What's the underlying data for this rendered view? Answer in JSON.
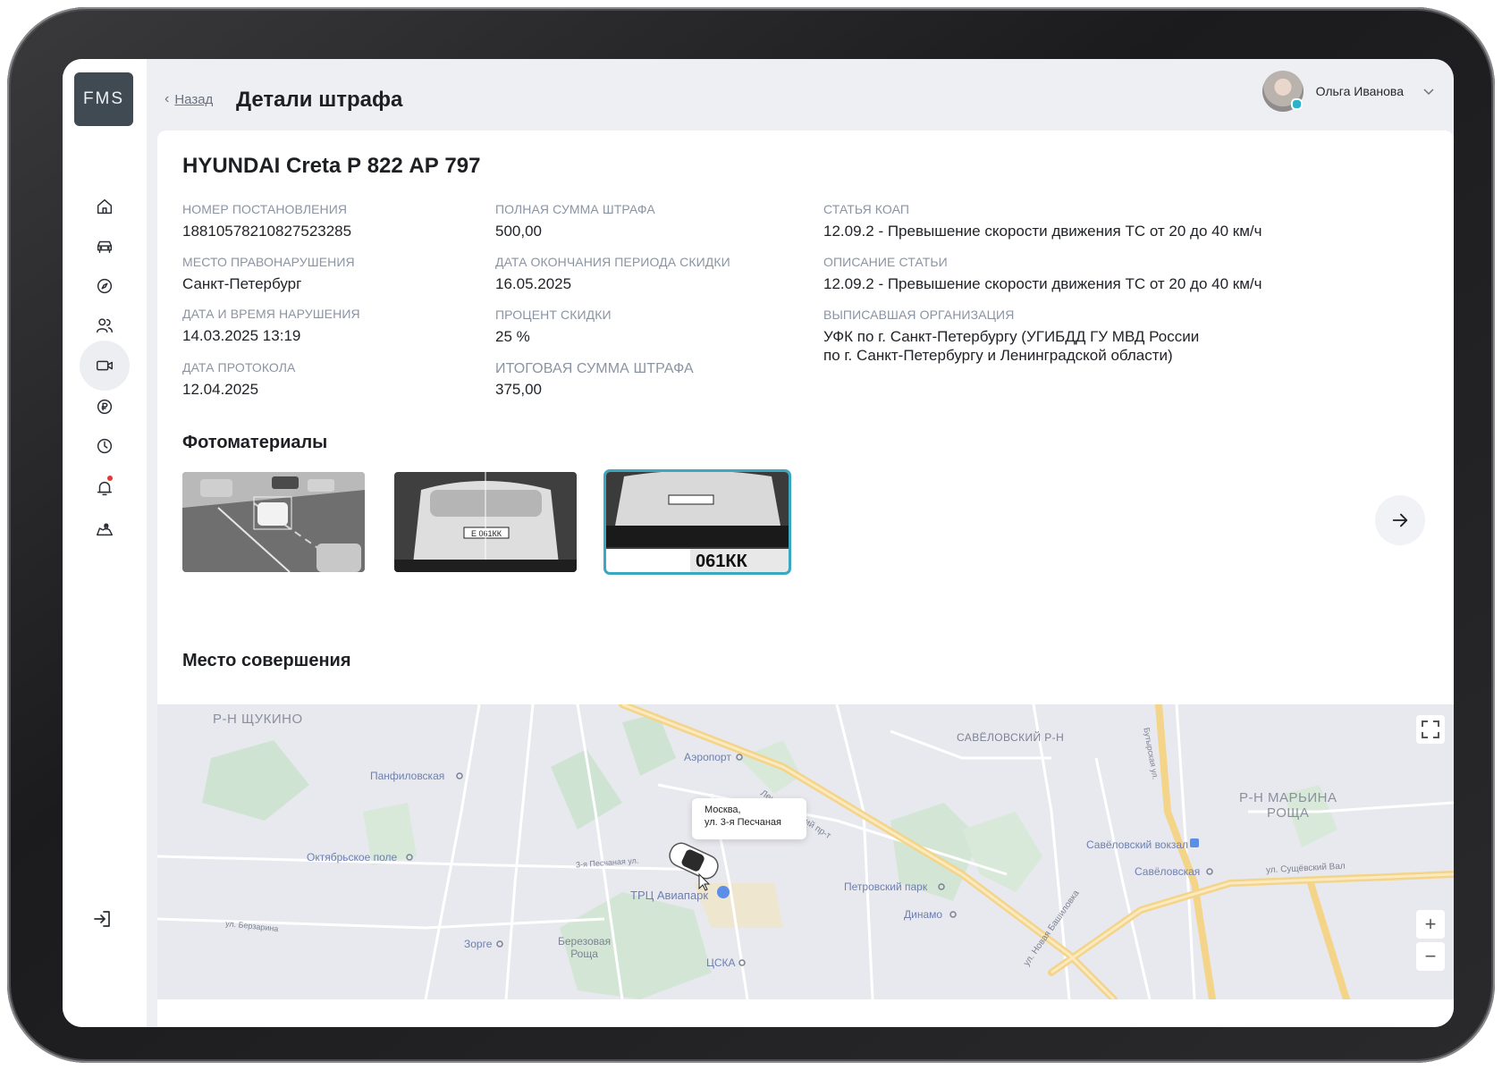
{
  "app": {
    "logo": "FMS"
  },
  "header": {
    "back_label": "Назад",
    "title": "Детали штрафа",
    "user_name": "Ольга  Иванова"
  },
  "sidebar": {
    "items": [
      {
        "icon": "home-icon"
      },
      {
        "icon": "car-icon"
      },
      {
        "icon": "compass-icon"
      },
      {
        "icon": "users-icon"
      },
      {
        "icon": "video-camera-icon",
        "active": true
      },
      {
        "icon": "ruble-icon"
      },
      {
        "icon": "clock-icon"
      },
      {
        "icon": "bell-icon",
        "badge": true
      },
      {
        "icon": "map-pin-icon"
      }
    ],
    "logout_icon": "logout-icon"
  },
  "fine": {
    "vehicle": "HYUNDAI Creta Р 822 АР 797",
    "col1": [
      {
        "label": "НОМЕР ПОСТАНОВЛЕНИЯ",
        "value": "18810578210827523285"
      },
      {
        "label": "МЕСТО ПРАВОНАРУШЕНИЯ",
        "value": "Санкт-Петербург"
      },
      {
        "label": "ДАТА И ВРЕМЯ НАРУШЕНИЯ",
        "value": "14.03.2025 13:19"
      },
      {
        "label": "ДАТА ПРОТОКОЛА",
        "value": "12.04.2025"
      }
    ],
    "col2": [
      {
        "label": "ПОЛНАЯ СУММА ШТРАФА",
        "value": "500,00"
      },
      {
        "label": "ДАТА ОКОНЧАНИЯ ПЕРИОДА СКИДКИ",
        "value": "16.05.2025"
      },
      {
        "label": "ПРОЦЕНТ СКИДКИ",
        "value": "25 %"
      },
      {
        "label": "ИТОГОВАЯ СУММА ШТРАФА",
        "value": "375,00"
      }
    ],
    "col3": [
      {
        "label": "СТАТЬЯ КОАП",
        "value": "12.09.2 - Превышение скорости движения ТС от 20 до 40 км/ч"
      },
      {
        "label": "ОПИСАНИЕ СТАТЬИ",
        "value": "12.09.2 - Превышение скорости движения ТС от 20 до 40 км/ч"
      },
      {
        "label": "ВЫПИСАВШАЯ ОРГАНИЗАЦИЯ",
        "value": "УФК по г. Санкт-Петербургу (УГИБДД ГУ МВД России\n по г. Санкт-Петербургу и Ленинградской области)"
      }
    ]
  },
  "photos": {
    "title": "Фотоматериалы",
    "plate_text": "061КК",
    "selected_index": 2
  },
  "location": {
    "title": "Место совершения",
    "tooltip_line1": "Москва,",
    "tooltip_line2": "ул. 3-я Песчаная",
    "map_labels": {
      "district_shchukino": "Р-Н ЩУКИНО",
      "district_savelovsky": "САВЁЛОВСКИЙ Р-Н",
      "district_maryina_line1": "Р-Н МАРЬИНА",
      "district_maryina_line2": "РОЩА",
      "panfilovskaya": "Панфиловская",
      "aeroport": "Аэропорт",
      "oktyabrskoe": "Октябрьское поле",
      "trc": "ТРЦ Авиапарк",
      "petrovsky": "Петровский парк",
      "dinamo": "Динамо",
      "savelovsky_station": "Савёловский вокзал",
      "savelovskaya": "Савёловская",
      "zorge": "Зорге",
      "berezovaya_line1": "Березовая",
      "berezovaya_line2": "Роща",
      "cska": "ЦСКА",
      "leningradsky": "Ленинградский пр-т",
      "sushchevsky": "ул. Сущёвский Вал",
      "peschanaya": "3-я Песчаная ул.",
      "butyrskaya": "Бутырская ул.",
      "novaya_bashilovka": "ул. Новая Башиловка",
      "berzarina": "ул. Берзарина"
    },
    "zoom_in": "+",
    "zoom_out": "−"
  }
}
